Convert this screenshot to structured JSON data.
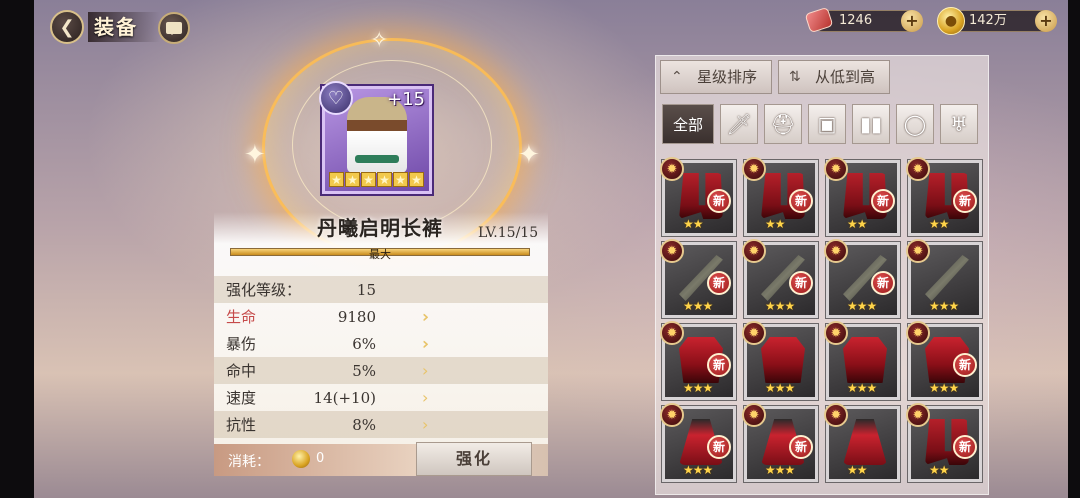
{
  "header": {
    "title": "装备",
    "back_icon": "chevron-left-icon",
    "chat_icon": "chat-bubble-icon"
  },
  "currencies": [
    {
      "name": "ticket",
      "icon": "ticket-icon",
      "value": "1246"
    },
    {
      "name": "gold",
      "icon": "gold-coin-icon",
      "value": "142万"
    }
  ],
  "item": {
    "name": "丹曦启明长裤",
    "enhance": "+15",
    "level": "LV.15/15",
    "xp_label": "最大",
    "xp_fraction": 1.0,
    "stars": 6,
    "badge_icon": "heart-icon"
  },
  "stats": [
    {
      "label": "强化等级：",
      "value": "15",
      "highlight": false
    },
    {
      "label": "生命",
      "value": "9180",
      "highlight": true
    },
    {
      "label": "暴伤",
      "value": "6%",
      "highlight": false
    },
    {
      "label": "命中",
      "value": "5%",
      "highlight": false
    },
    {
      "label": "速度",
      "value": "14(+10)",
      "highlight": false
    },
    {
      "label": "抗性",
      "value": "8%",
      "highlight": false
    }
  ],
  "cost": {
    "label": "消耗：",
    "value": "0"
  },
  "enhance_button": "强化",
  "sort": {
    "star_sort": "星级排序",
    "order": "从低到高"
  },
  "filters": [
    {
      "label": "全部",
      "icon": "",
      "active": true
    },
    {
      "label": "",
      "icon": "sword-icon",
      "active": false
    },
    {
      "label": "",
      "icon": "helmet-icon",
      "active": false
    },
    {
      "label": "",
      "icon": "armor-icon",
      "active": false
    },
    {
      "label": "",
      "icon": "boots-icon",
      "active": false
    },
    {
      "label": "",
      "icon": "ring-icon",
      "active": false
    },
    {
      "label": "",
      "icon": "amulet-icon",
      "active": false
    }
  ],
  "inventory": [
    {
      "type": "boots",
      "stars": 2,
      "new": true
    },
    {
      "type": "boots",
      "stars": 2,
      "new": true
    },
    {
      "type": "boots",
      "stars": 2,
      "new": true
    },
    {
      "type": "boots",
      "stars": 2,
      "new": true
    },
    {
      "type": "sword",
      "stars": 3,
      "new": true
    },
    {
      "type": "sword",
      "stars": 3,
      "new": true
    },
    {
      "type": "sword",
      "stars": 3,
      "new": true
    },
    {
      "type": "sword",
      "stars": 3,
      "new": false
    },
    {
      "type": "armor",
      "stars": 3,
      "new": true
    },
    {
      "type": "armor",
      "stars": 3,
      "new": false
    },
    {
      "type": "armor",
      "stars": 3,
      "new": false
    },
    {
      "type": "armor",
      "stars": 3,
      "new": true
    },
    {
      "type": "robe",
      "stars": 3,
      "new": true
    },
    {
      "type": "robe",
      "stars": 3,
      "new": true
    },
    {
      "type": "robe",
      "stars": 2,
      "new": false
    },
    {
      "type": "boots",
      "stars": 2,
      "new": true
    }
  ],
  "new_label": "新"
}
